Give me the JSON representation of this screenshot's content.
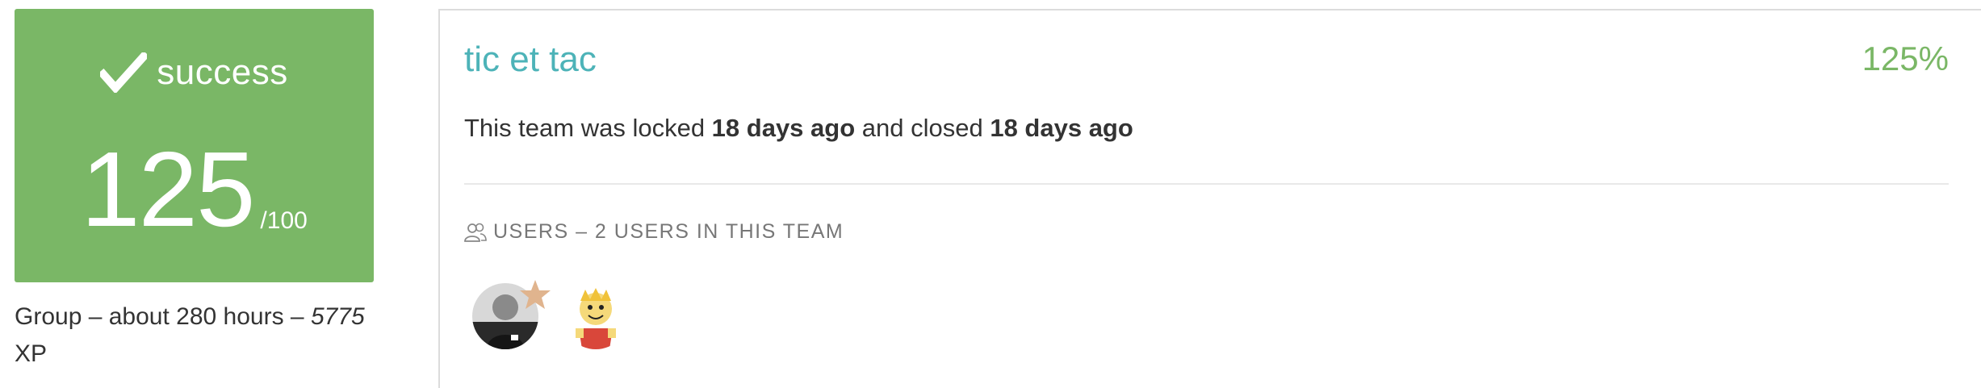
{
  "status": {
    "label": "success",
    "score": "125",
    "max": "/100",
    "color": "#7ab766"
  },
  "group_meta": {
    "text": "Group – about 280 hours – ",
    "xp_value": "5775",
    "xp_unit": " XP"
  },
  "team": {
    "name": "tic et tac",
    "percent": "125%",
    "status_prefix": "This team was locked ",
    "locked_ago": "18 days ago",
    "status_middle": " and closed ",
    "closed_ago": "18 days ago",
    "name_color": "#4db3b8"
  },
  "users": {
    "header": "Users – 2 users in this team",
    "icon": "users-icon",
    "avatars": [
      {
        "name": "user-avatar-leader",
        "badge": "star-icon"
      },
      {
        "name": "user-avatar-cartoon"
      }
    ]
  }
}
